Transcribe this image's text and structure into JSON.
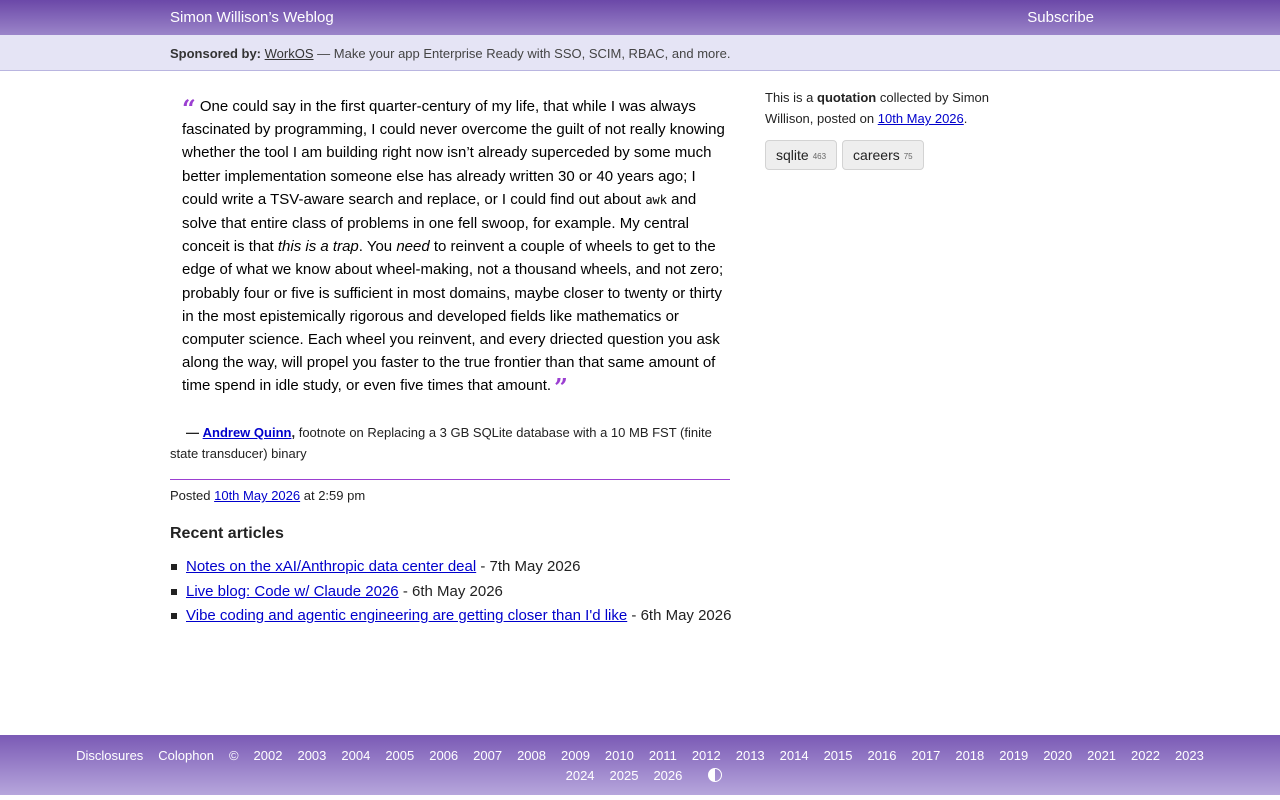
{
  "header": {
    "site_title": "Simon Willison’s Weblog",
    "subscribe_label": "Subscribe"
  },
  "sponsor": {
    "label": "Sponsored by:",
    "name": "WorkOS",
    "text": "— Make your app Enterprise Ready with SSO, SCIM, RBAC, and more."
  },
  "quote": {
    "p1": "One could say in the first quarter-century of my life, that while I was always fascinated by programming, I could never overcome the guilt of not really knowing whether the tool I am building right now isn’t already superceded by some much better implementation someone else has already written 30 or 40 years ago; I could write a TSV-aware search and replace, or I could find out about ",
    "code": "awk",
    "p2": " and solve that entire class of problems in one fell swoop, for example. My central conceit is that ",
    "em1": "this is a trap",
    "p3": ". You ",
    "em2": "need",
    "p4": " to reinvent a couple of wheels to get to the edge of what we know about wheel-making, not a thousand wheels, and not zero; probably four or five is sufficient in most domains, maybe closer to twenty or thirty in the most epistemically rigorous and developed fields like mathematics or computer science. Each wheel you reinvent, and every driected question you ask along the way, will propel you faster to the true frontier than that same amount of time spend in idle study, or even five times that amount."
  },
  "citation": {
    "dash": "—",
    "author": "Andrew Quinn",
    "comma": ",",
    "text": "footnote on Replacing a 3 GB SQLite database with a 10 MB FST (finite state transducer) binary"
  },
  "posted": {
    "prefix": "Posted",
    "date": "10th May 2026",
    "time": "at 2:59 pm"
  },
  "recent": {
    "heading": "Recent articles",
    "items": [
      {
        "title": "Notes on the xAI/Anthropic data center deal",
        "date": "- 7th May 2026"
      },
      {
        "title": "Live blog: Code w/ Claude 2026",
        "date": "- 6th May 2026"
      },
      {
        "title": "Vibe coding and agentic engineering are getting closer than I'd like",
        "date": "- 6th May 2026"
      }
    ]
  },
  "sidebar": {
    "prefix": "This is a",
    "kind": "quotation",
    "mid": "collected by Simon Willison, posted on",
    "date": "10th May 2026",
    "suffix": ".",
    "tags": [
      {
        "name": "sqlite",
        "count": "463"
      },
      {
        "name": "careers",
        "count": "75"
      }
    ]
  },
  "footer": {
    "links": [
      "Disclosures",
      "Colophon",
      "©",
      "2002",
      "2003",
      "2004",
      "2005",
      "2006",
      "2007",
      "2008",
      "2009",
      "2010",
      "2011",
      "2012",
      "2013",
      "2014",
      "2015",
      "2016",
      "2017",
      "2018",
      "2019",
      "2020",
      "2021",
      "2022",
      "2023"
    ],
    "links2": [
      "2024",
      "2025",
      "2026"
    ],
    "theme_icon": "contrast-icon"
  },
  "colors": {
    "accent": "#9b3fd1",
    "header": "#6b48a8",
    "sponsor_bg": "#e5e4f5",
    "link": "#0000cc"
  }
}
